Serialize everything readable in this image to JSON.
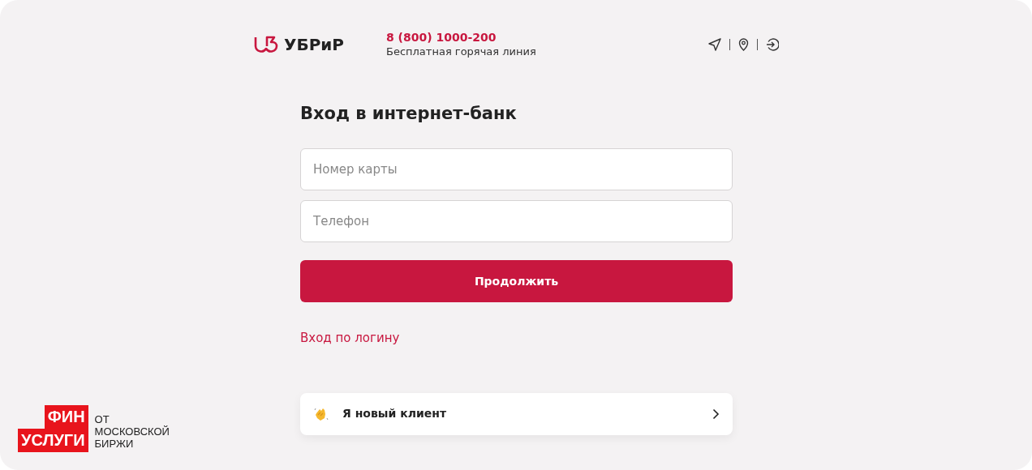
{
  "header": {
    "brand": "УБРиР",
    "phone": "8 (800) 1000-200",
    "phone_caption": "Бесплатная горячая линия"
  },
  "login": {
    "title": "Вход в интернет-банк",
    "fields": [
      {
        "placeholder": "Номер карты"
      },
      {
        "placeholder": "Телефон"
      }
    ],
    "submit": "Продолжить",
    "alt_login": "Вход по логину",
    "new_client": "Я новый клиент"
  },
  "partner": {
    "badge_lines": [
      "ФИН",
      "УСЛУГИ"
    ],
    "tagline_lines": [
      "ОТ",
      "МОСКОВСКОЙ",
      "БИРЖИ"
    ]
  }
}
